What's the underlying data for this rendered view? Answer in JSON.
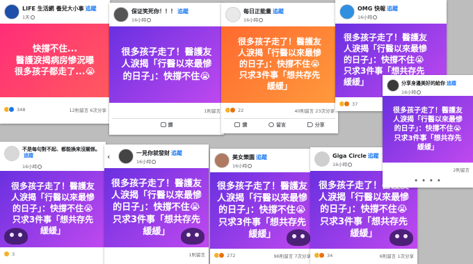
{
  "posts": [
    {
      "author": "LIFE 生活網 養兒大小事",
      "follow": "追蹤",
      "meta": "1天",
      "card": "快撐不住...\n醫護淚揭病房慘況曝\n很多孩子都走了...😭",
      "reactions": "348",
      "counts": "12則留言  6次分享",
      "avatar_color": "#1f4fa8"
    },
    {
      "author": "保证笑死你！！！",
      "follow": "追蹤",
      "meta": "16小時",
      "card": "很多孩子走了！醫護友\n人淚揭「行醫以來最慘\n的日子」：快撐不住😭",
      "reactions": "",
      "counts": "1則留言",
      "avatar_color": "#555555"
    },
    {
      "author": "每日正能量",
      "follow": "追蹤",
      "meta": "16小時",
      "card": "很多孩子走了！醫護友\n人淚揭「行醫以來最慘\n的日子」：快撐不住😭\n只求3件事「想共存先\n緩緩」",
      "reactions": "22",
      "counts": "40則留言  23次分享",
      "avatar_color": "#e9e9e9"
    },
    {
      "author": "OMG 快報",
      "follow": "追蹤",
      "meta": "16小時",
      "card": "很多孩子走了！醫護友\n人淚揭「行醫以來最慘\n的日子」：快撐不住😭\n只求3件事「想共存先\n緩緩」",
      "reactions": "37",
      "counts": "",
      "avatar_color": "#2f8fe0"
    },
    {
      "author": "分享身邊美好的給你",
      "follow": "追蹤",
      "meta": "16小時",
      "card": "很多孩子走了！醫護友\n人淚揭「行醫以來最慘\n的日子」：快撐不住😭\n只求3件事「想共存先\n緩緩」",
      "reactions": "",
      "counts": "2則留言",
      "avatar_color": "#3a3a3a"
    },
    {
      "author": "不是每句對不起、都能換來沒關係。",
      "follow": "追蹤",
      "meta": "16小時",
      "card": "很多孩子走了！醫護友\n人淚揭「行醫以來最慘\n的日子」：快撐不住😭\n只求3件事「想共存先\n緩緩」",
      "reactions": "3",
      "counts": "",
      "avatar_color": "#d8d8d8"
    },
    {
      "author": "一見你就發財",
      "follow": "追蹤",
      "meta": "16小時",
      "card": "很多孩子走了！醫護友\n人淚揭「行醫以來最慘\n的日子」：快撐不住😭\n只求3件事「想共存先\n緩緩」",
      "reactions": "",
      "counts": "1則留言",
      "avatar_color": "#444444"
    },
    {
      "author": "美女樂園",
      "follow": "追蹤",
      "meta": "16小時",
      "card": "很多孩子走了！醫護友\n人淚揭「行醫以來最慘\n的日子」：快撐不住😭\n只求3件事「想共存先\n緩緩」",
      "reactions": "272",
      "counts": "96則留言  7次分享",
      "avatar_color": "#b07a62"
    },
    {
      "author": "Giga Circle",
      "follow": "追蹤",
      "meta": "16小時",
      "card": "很多孩子走了！醫護友\n人淚揭「行醫以來最慘\n的日子」：快撐不住😭\n只求3件事「想共存先\n緩緩」",
      "reactions": "34",
      "counts": "6則留言  1次分享",
      "avatar_color": "#cfcfcf"
    }
  ],
  "actions": {
    "like": "讚",
    "comment": "留言",
    "share": "分享"
  },
  "colors": {
    "follow": "#1877f2",
    "pink_card": "#ff2d78",
    "orange_card": "#ff7a33",
    "purple_card": "#9b3fe8"
  }
}
